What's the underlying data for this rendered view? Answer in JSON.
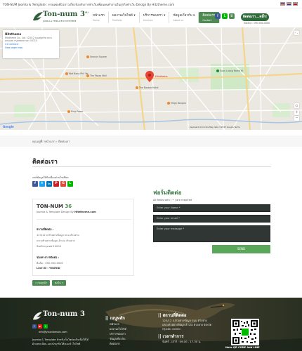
{
  "topbar": {
    "text": "TON-NUM Joomla & Template : ทามเพลย์นิวบ่าวเกี่ยวข้องกับการทำเว็บเพื่อนคนทำงานในธุรกิจทำเว็บ Design By Hitztheme.com"
  },
  "header": {
    "logo_name": "Ton-num 3",
    "logo_sup": "(4)",
    "logo_sub": "JOOMLA & TEMPLATE BY HITZTHEME",
    "nav": [
      {
        "label": "หน้าแรก",
        "sub": "Home"
      },
      {
        "label": "ผลงานเว็บไซต์",
        "sub": "Portfolio"
      },
      {
        "label": "บริการของเรา",
        "sub": "Services"
      },
      {
        "label": "ข้อมูลเกี่ยวกับ",
        "sub": "About us"
      },
      {
        "label": "ติดต่อเรา",
        "sub": "Contact"
      }
    ],
    "cta": "ติดต่อเรา...คลิ๊ก!",
    "cta_number": "Hotline : 090-900-0000"
  },
  "map": {
    "place_title": "Hitztheme",
    "place_address": "Hitztheme Co., Ltd. 123/12 ถนนสุขุมวิท แขวงคลองเตย กรุงเทพมหานคร 10110",
    "rating": "4.6 ★★★★★",
    "larger_map": "View larger map",
    "places": [
      "Seacon Square",
      "Wat Bang Phli Yai",
      "The Paseo Mall",
      "The Bazaar Hotel",
      "Hitztheme",
      "Suan Luang Rama IX",
      "Mega Bangna",
      "King Power"
    ],
    "attribution": "Keyboard shortcuts  Map data ©2023 Google  Terms"
  },
  "breadcrumb": {
    "home": "หน้าแรก",
    "current": "ติดต่อเรา",
    "prefix": "คุณอยู่ที่:"
  },
  "page": {
    "title": "ติดต่อเรา",
    "share_text": "แชร์ข้อมูลให้กับเพื่อนผ่านโซเชียล"
  },
  "share_buttons": [
    {
      "icon": "facebook-icon",
      "glyph": "f",
      "color": "#3b5998"
    },
    {
      "icon": "twitter-icon",
      "glyph": "t",
      "color": "#1da1f2"
    },
    {
      "icon": "linkedin-icon",
      "glyph": "in",
      "color": "#0077b5"
    },
    {
      "icon": "pinterest-icon",
      "glyph": "P",
      "color": "#cb2027"
    },
    {
      "icon": "google-icon",
      "glyph": "G",
      "color": "#dd4b39"
    },
    {
      "icon": "line-icon",
      "glyph": "L",
      "color": "#00b900"
    }
  ],
  "contact_card": {
    "brand": "TON-NUM",
    "brand_num": "36",
    "tagline_prefix": "Joomla & Template Design By",
    "tagline_link": "Hitztheme.com",
    "address_label": "สถานที่ติดต่อ :",
    "address_lines": [
      "123/12 ถ.ทัวอย่างข้อมูล ถนน ตัวอย่าง",
      "แขวงตัวอย่างข้อมูล อำเภอ ตัวอย่าง",
      "จังหวัดกรุงเทพ 10000"
    ],
    "contact_label": "ช่องทางการติดต่อ :",
    "mobile": "มือถือ : 090-900-0000",
    "line": "Line ID : YOURID"
  },
  "pager": {
    "prev": "« ก่อนหน้า",
    "next": "ต่อไป »"
  },
  "form": {
    "heading": "ฟอร์มติดต่อ",
    "sub": "All fields with ( * ) are required",
    "name_placeholder": "Enter your Name *",
    "email_placeholder": "Enter your email *",
    "message_placeholder": "Enter your message *",
    "send_label": "SEND"
  },
  "footer": {
    "logo_name": "Ton-num 3",
    "email": "info@yourdomain.com",
    "desc_lines": [
      "Joomla & Template สำหรับเว็บไซต์ธุรกิจเพื่อให้ได้",
      "ผ้าลงทะเบียน และนักธุรกิจโต้กเบอร์ เว็บไซต์"
    ],
    "menu_heading": "|| เมนูหลัก",
    "menu_items": [
      "หน้าแรก",
      "ผลงานเว็บไซต์",
      "บริการของเรา",
      "ข้อมูลเกี่ยวกับ",
      "ติดต่อเรา"
    ],
    "addr_heading": "|| สถานที่ติดต่อ",
    "addr_lines": [
      "123/12 ถ.ตัวอย่างข้อมูล ถนน ตัวอย่าง",
      "แขวงตัวอย่างข้อมูล อำเภอ ตัวอย่าง จังหวัด",
      "กรุงเทพ 10000"
    ],
    "hours_heading": "|| เวลาทำการ",
    "hours": "จันทร์ - เสาร์ : 09.00 - 17.30 น.",
    "qr_caption": "Note QR CODE Add LINE"
  }
}
